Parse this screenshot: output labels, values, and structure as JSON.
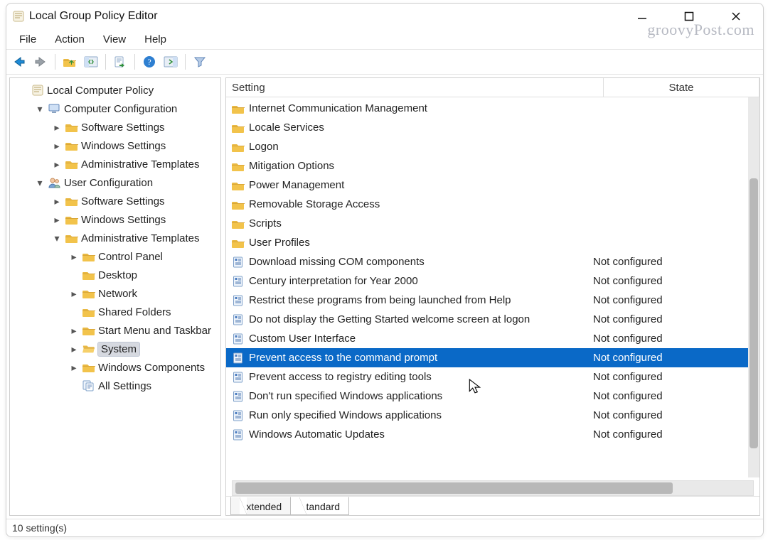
{
  "window": {
    "title": "Local Group Policy Editor",
    "watermark": "groovyPost.com"
  },
  "menubar": {
    "items": [
      "File",
      "Action",
      "View",
      "Help"
    ]
  },
  "toolbar": {
    "icons": [
      "back",
      "forward",
      "sep",
      "up",
      "show-hide-tree",
      "sep",
      "export-list",
      "sep",
      "help",
      "show-hide-action",
      "sep",
      "filter"
    ]
  },
  "tree": {
    "root": {
      "label": "Local Computer Policy",
      "icon": "policy"
    },
    "nodes": [
      {
        "indent": 0,
        "twist": "none",
        "icon": "policy-root",
        "label": "Local Computer Policy"
      },
      {
        "indent": 1,
        "twist": "down",
        "icon": "computer-config",
        "label": "Computer Configuration"
      },
      {
        "indent": 2,
        "twist": "right",
        "icon": "folder",
        "label": "Software Settings"
      },
      {
        "indent": 2,
        "twist": "right",
        "icon": "folder",
        "label": "Windows Settings"
      },
      {
        "indent": 2,
        "twist": "right",
        "icon": "folder",
        "label": "Administrative Templates"
      },
      {
        "indent": 1,
        "twist": "down",
        "icon": "user-config",
        "label": "User Configuration"
      },
      {
        "indent": 2,
        "twist": "right",
        "icon": "folder",
        "label": "Software Settings"
      },
      {
        "indent": 2,
        "twist": "right",
        "icon": "folder",
        "label": "Windows Settings"
      },
      {
        "indent": 2,
        "twist": "down",
        "icon": "folder",
        "label": "Administrative Templates"
      },
      {
        "indent": 3,
        "twist": "right",
        "icon": "folder",
        "label": "Control Panel"
      },
      {
        "indent": 3,
        "twist": "none",
        "icon": "folder",
        "label": "Desktop"
      },
      {
        "indent": 3,
        "twist": "right",
        "icon": "folder",
        "label": "Network"
      },
      {
        "indent": 3,
        "twist": "none",
        "icon": "folder",
        "label": "Shared Folders"
      },
      {
        "indent": 3,
        "twist": "right",
        "icon": "folder",
        "label": "Start Menu and Taskbar"
      },
      {
        "indent": 3,
        "twist": "right",
        "icon": "folder-open",
        "label": "System",
        "selected": true
      },
      {
        "indent": 3,
        "twist": "right",
        "icon": "folder",
        "label": "Windows Components"
      },
      {
        "indent": 3,
        "twist": "none",
        "icon": "all-settings",
        "label": "All Settings"
      }
    ]
  },
  "list": {
    "columns": {
      "setting": "Setting",
      "state": "State"
    },
    "items": [
      {
        "icon": "folder",
        "name": "Internet Communication Management",
        "state": ""
      },
      {
        "icon": "folder",
        "name": "Locale Services",
        "state": ""
      },
      {
        "icon": "folder",
        "name": "Logon",
        "state": ""
      },
      {
        "icon": "folder",
        "name": "Mitigation Options",
        "state": ""
      },
      {
        "icon": "folder",
        "name": "Power Management",
        "state": ""
      },
      {
        "icon": "folder",
        "name": "Removable Storage Access",
        "state": ""
      },
      {
        "icon": "folder",
        "name": "Scripts",
        "state": ""
      },
      {
        "icon": "folder",
        "name": "User Profiles",
        "state": ""
      },
      {
        "icon": "setting",
        "name": "Download missing COM components",
        "state": "Not configured"
      },
      {
        "icon": "setting",
        "name": "Century interpretation for Year 2000",
        "state": "Not configured"
      },
      {
        "icon": "setting",
        "name": "Restrict these programs from being launched from Help",
        "state": "Not configured"
      },
      {
        "icon": "setting",
        "name": "Do not display the Getting Started welcome screen at logon",
        "state": "Not configured"
      },
      {
        "icon": "setting",
        "name": "Custom User Interface",
        "state": "Not configured"
      },
      {
        "icon": "setting",
        "name": "Prevent access to the command prompt",
        "state": "Not configured",
        "selected": true
      },
      {
        "icon": "setting",
        "name": "Prevent access to registry editing tools",
        "state": "Not configured"
      },
      {
        "icon": "setting",
        "name": "Don't run specified Windows applications",
        "state": "Not configured"
      },
      {
        "icon": "setting",
        "name": "Run only specified Windows applications",
        "state": "Not configured"
      },
      {
        "icon": "setting",
        "name": "Windows Automatic Updates",
        "state": "Not configured"
      }
    ],
    "tabs": {
      "extended": "Extended",
      "standard": "Standard",
      "active": "standard"
    }
  },
  "statusbar": {
    "text": "10 setting(s)"
  }
}
